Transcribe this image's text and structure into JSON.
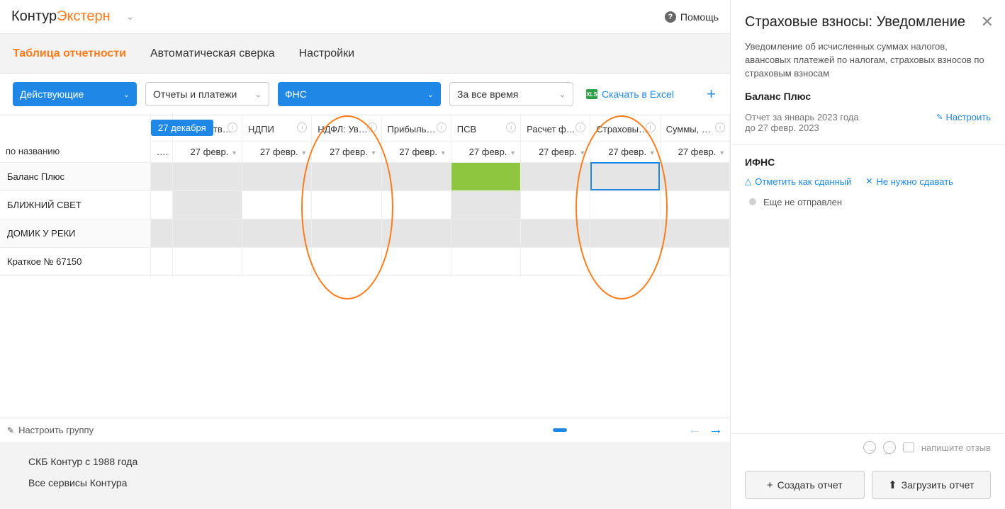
{
  "header": {
    "logo_k": "Контур",
    "logo_e": "Экстерн",
    "help": "Помощь"
  },
  "tabs": {
    "reporting": "Таблица отчетности",
    "reconcile": "Автоматическая сверка",
    "settings": "Настройки"
  },
  "filters": {
    "status": "Действующие",
    "type": "Отчеты и платежи",
    "authority": "ФНС",
    "period": "За все время",
    "excel": "Скачать в Excel"
  },
  "badge_date": "27 декабря",
  "grid": {
    "name_header": "по названию",
    "columns": [
      "Имуществ…",
      "НДПИ",
      "НДФЛ: Ув…",
      "Прибыль…",
      "ПСВ",
      "Расчет ф…",
      "Страховы…",
      "Суммы, …"
    ],
    "date_label": "27 февр.",
    "rows": [
      "Баланс Плюс",
      "БЛИЖНИЙ СВЕТ",
      "ДОМИК У РЕКИ",
      "Краткое № 67150"
    ]
  },
  "groupbar": {
    "label": "Настроить группу"
  },
  "footer": {
    "line1": "СКБ Контур с 1988 года",
    "line2": "Все сервисы Контура"
  },
  "panel": {
    "title": "Страховые взносы: Уведомление",
    "desc": "Уведомление об исчисленных суммах налогов, авансовых платежей по налогам, страховых взносов по страховым взносам",
    "org": "Баланс Плюс",
    "period_line1": "Отчет за январь 2023 года",
    "period_line2": "до 27 февр. 2023",
    "configure": "Настроить",
    "section": "ИФНС",
    "mark_submitted": "Отметить как сданный",
    "no_need": "Не нужно сдавать",
    "status": "Еще не отправлен",
    "feedback_hint": "напишите отзыв",
    "btn_create": "Создать отчет",
    "btn_upload": "Загрузить отчет"
  }
}
